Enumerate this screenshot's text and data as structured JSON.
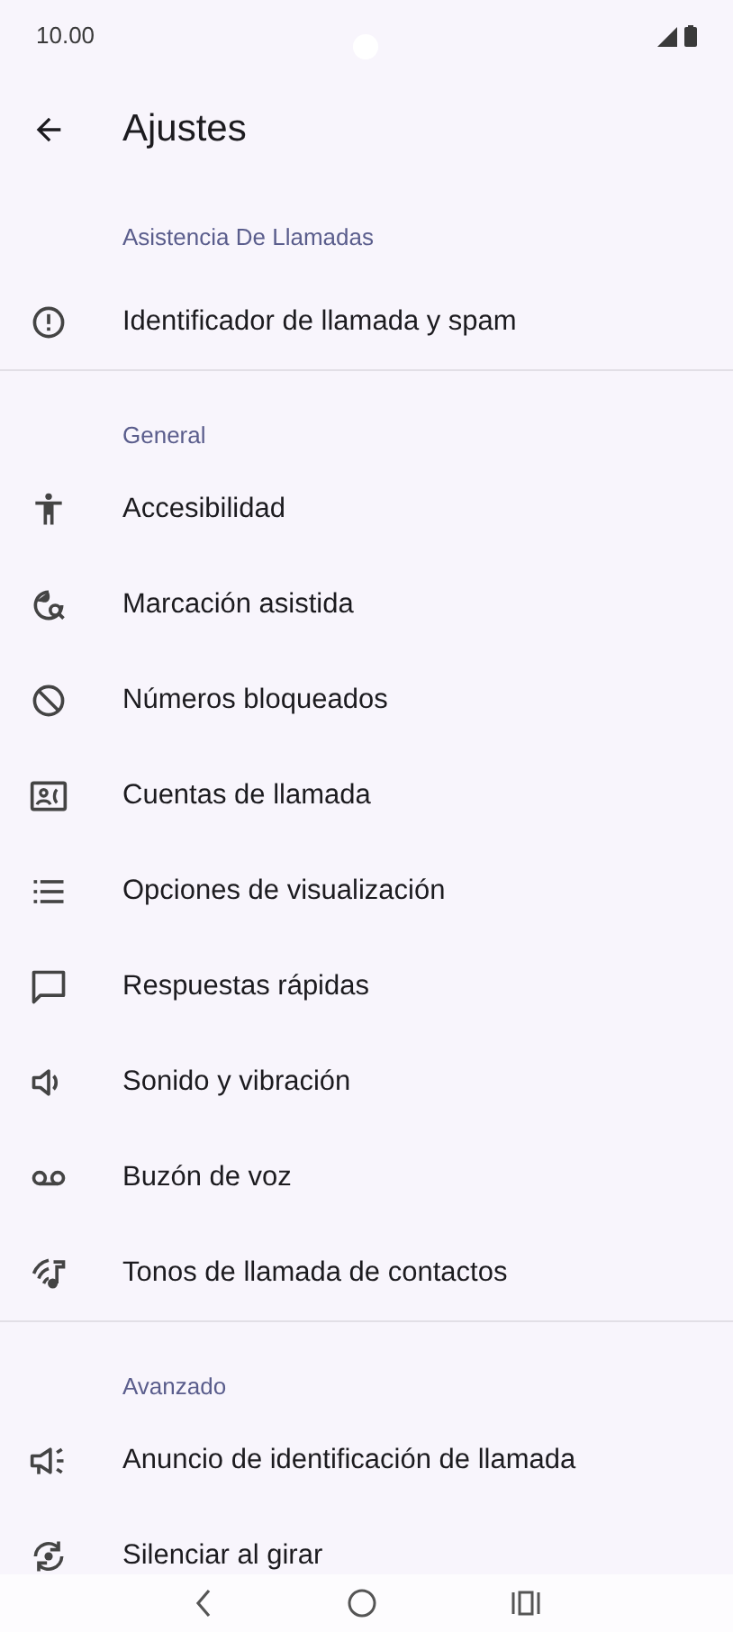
{
  "status_bar": {
    "time": "10.00"
  },
  "app_bar": {
    "title": "Ajustes"
  },
  "sections": [
    {
      "header": "Asistencia De Llamadas",
      "items": [
        {
          "label": "Identificador de llamada y spam"
        }
      ]
    },
    {
      "header": "General",
      "items": [
        {
          "label": "Accesibilidad"
        },
        {
          "label": "Marcación asistida"
        },
        {
          "label": "Números bloqueados"
        },
        {
          "label": "Cuentas de llamada"
        },
        {
          "label": "Opciones de visualización"
        },
        {
          "label": "Respuestas rápidas"
        },
        {
          "label": "Sonido y vibración"
        },
        {
          "label": "Buzón de voz"
        },
        {
          "label": "Tonos de llamada de contactos"
        }
      ]
    },
    {
      "header": "Avanzado",
      "items": [
        {
          "label": "Anuncio de identificación de llamada"
        },
        {
          "label": "Silenciar al girar"
        }
      ]
    }
  ]
}
